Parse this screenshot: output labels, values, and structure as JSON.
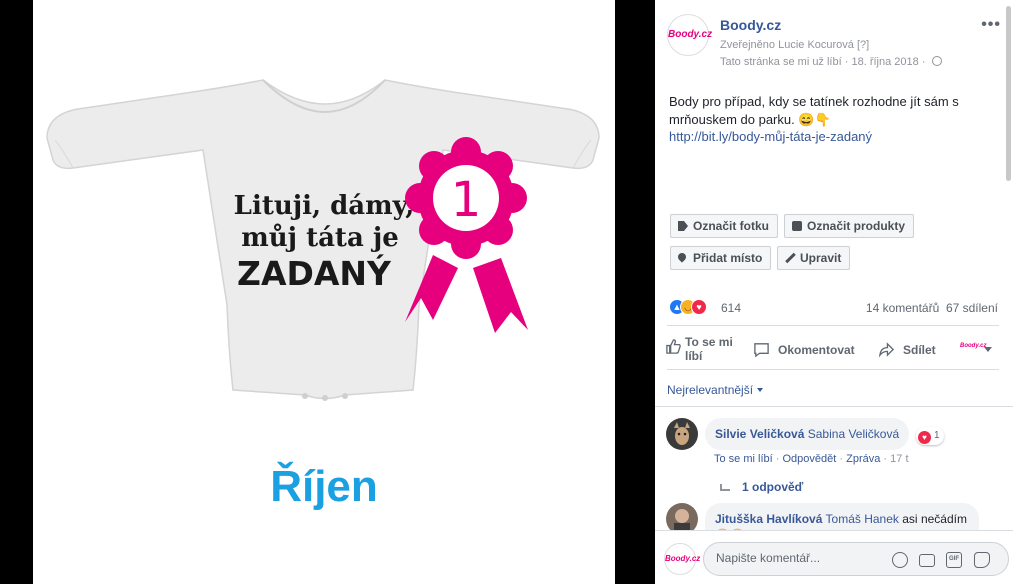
{
  "photo": {
    "shirt_line1": "Lituji, dámy,",
    "shirt_line2": "můj táta je",
    "shirt_line3": "ZADANÝ",
    "badge_number": "1",
    "month": "Říjen"
  },
  "post": {
    "page_avatar_text": "Boody.cz",
    "page_name": "Boody.cz",
    "published_by": "Zveřejněno Lucie Kocurová",
    "published_hint": "[?]",
    "liked_status": "Tato stránka se mi už líbí",
    "date": "18. října 2018",
    "text": "Body pro případ, kdy se tatínek rozhodne jít sám s mrňouskem do parku. 😄👇",
    "link": "http://bit.ly/body-můj-táta-je-zadaný"
  },
  "tags": {
    "tag_photo": "Označit fotku",
    "tag_products": "Označit produkty",
    "add_place": "Přidat místo",
    "edit": "Upravit"
  },
  "stats": {
    "reaction_count": "614",
    "comments": "14 komentářů",
    "shares": "67 sdílení"
  },
  "actions": {
    "like": "To se mi líbí",
    "comment": "Okomentovat",
    "share": "Sdílet"
  },
  "comments_sort": "Nejrelevantnější",
  "comments": [
    {
      "author": "Silvie Veličková",
      "text": "Sabina Veličková",
      "reaction_count": "1",
      "like_label": "To se mi líbí",
      "reply_label": "Odpovědět",
      "message_label": "Zpráva",
      "time": "17 t",
      "replies": "1 odpověď"
    },
    {
      "author": "Jitušška Havlíková",
      "tagged": "Tomáš Hanek",
      "text": "asi",
      "text_cont": "nečádím 😁😂"
    }
  ],
  "composer": {
    "avatar_text": "Boody.cz",
    "placeholder": "Napište komentář..."
  },
  "icons": {
    "more": "more-icon",
    "globe": "globe-icon",
    "tag": "tag-icon",
    "bag": "bag-icon",
    "pin": "pin-icon",
    "pencil": "pencil-icon"
  },
  "colors": {
    "link": "#365899",
    "badge": "#e6007e",
    "month": "#1ba1e2"
  }
}
